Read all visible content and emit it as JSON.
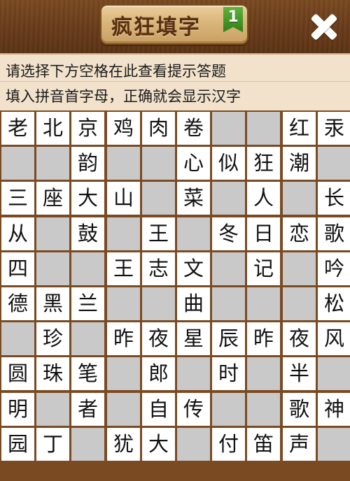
{
  "header": {
    "title": "疯狂填字",
    "level": "1"
  },
  "hints": {
    "line1": "请选择下方空格在此查看提示答题",
    "line2": "填入拼音首字母，正确就会显示汉字"
  },
  "colors": {
    "wood": "#7a4a22",
    "blank_cell": "#c9c9c9",
    "hint_bg": "#f2e2cc",
    "badge_green": "#3a8f20"
  },
  "grid": [
    [
      "老",
      "北",
      "京",
      "鸡",
      "肉",
      "卷",
      null,
      null,
      "红",
      "汞"
    ],
    [
      null,
      null,
      "韵",
      null,
      null,
      "心",
      "似",
      "狂",
      "潮",
      null
    ],
    [
      "三",
      "座",
      "大",
      "山",
      null,
      "菜",
      null,
      "人",
      null,
      "长"
    ],
    [
      "从",
      null,
      "鼓",
      null,
      "王",
      null,
      "冬",
      "日",
      "恋",
      "歌"
    ],
    [
      "四",
      null,
      null,
      "王",
      "志",
      "文",
      null,
      "记",
      null,
      "吟"
    ],
    [
      "德",
      "黑",
      "兰",
      null,
      null,
      "曲",
      null,
      null,
      null,
      "松"
    ],
    [
      null,
      "珍",
      null,
      "昨",
      "夜",
      "星",
      "辰",
      "昨",
      "夜",
      "风"
    ],
    [
      "圆",
      "珠",
      "笔",
      null,
      "郎",
      null,
      "时",
      null,
      "半",
      null
    ],
    [
      "明",
      null,
      "者",
      null,
      "自",
      "传",
      null,
      null,
      "歌",
      "神"
    ],
    [
      "园",
      "丁",
      null,
      "犹",
      "大",
      null,
      "付",
      "笛",
      "声",
      null
    ]
  ]
}
